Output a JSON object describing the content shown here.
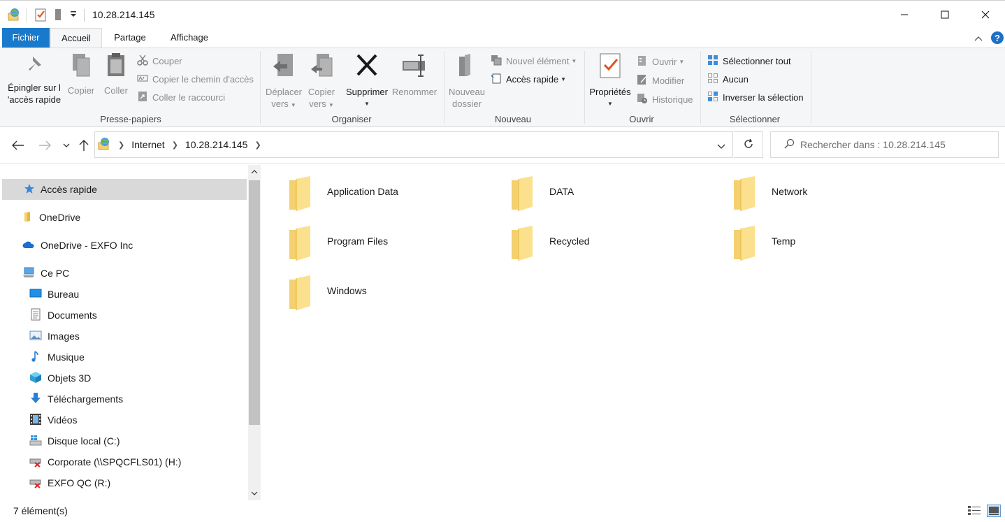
{
  "window": {
    "title": "10.28.214.145"
  },
  "ribbon_tabs": {
    "file": "Fichier",
    "home": "Accueil",
    "share": "Partage",
    "view": "Affichage"
  },
  "clipboard": {
    "pin_line1": "Épingler sur l",
    "pin_line2": "'accès rapide",
    "copy": "Copier",
    "paste": "Coller",
    "cut": "Couper",
    "copy_path": "Copier le chemin d'accès",
    "paste_shortcut": "Coller le raccourci",
    "group_label": "Presse-papiers"
  },
  "organize": {
    "move_line1": "Déplacer",
    "move_line2": "vers",
    "copyto_line1": "Copier",
    "copyto_line2": "vers",
    "delete": "Supprimer",
    "rename": "Renommer",
    "group_label": "Organiser"
  },
  "new": {
    "folder_line1": "Nouveau",
    "folder_line2": "dossier",
    "new_item": "Nouvel élément",
    "easy_access": "Accès rapide",
    "group_label": "Nouveau"
  },
  "open": {
    "properties": "Propriétés",
    "open": "Ouvrir",
    "edit": "Modifier",
    "history": "Historique",
    "group_label": "Ouvrir"
  },
  "select": {
    "select_all": "Sélectionner tout",
    "select_none": "Aucun",
    "invert": "Inverser la sélection",
    "group_label": "Sélectionner"
  },
  "address": {
    "crumbs": [
      "Internet",
      "10.28.214.145"
    ],
    "search_placeholder": "Rechercher dans : 10.28.214.145"
  },
  "navpane": {
    "items": [
      {
        "label": "Accès rapide",
        "icon": "star-icon",
        "selected": true
      },
      {
        "label": "OneDrive",
        "icon": "folder-icon"
      },
      {
        "label": "OneDrive - EXFO Inc",
        "icon": "cloud-icon"
      },
      {
        "label": "Ce PC",
        "icon": "computer-icon"
      },
      {
        "label": "Bureau",
        "icon": "desktop-icon"
      },
      {
        "label": "Documents",
        "icon": "document-icon"
      },
      {
        "label": "Images",
        "icon": "image-icon"
      },
      {
        "label": "Musique",
        "icon": "music-icon"
      },
      {
        "label": "Objets 3D",
        "icon": "cube-icon"
      },
      {
        "label": "Téléchargements",
        "icon": "download-icon"
      },
      {
        "label": "Vidéos",
        "icon": "video-icon"
      },
      {
        "label": "Disque local (C:)",
        "icon": "drive-icon"
      },
      {
        "label": "Corporate (\\\\SPQCFLS01) (H:)",
        "icon": "network-drive-disconnected-icon"
      },
      {
        "label": "EXFO QC (R:)",
        "icon": "network-drive-disconnected-icon"
      }
    ]
  },
  "content": {
    "folders": [
      "Application Data",
      "DATA",
      "Network",
      "Program Files",
      "Recycled",
      "Temp",
      "Windows"
    ]
  },
  "status": {
    "count": "7 élément(s)"
  },
  "colors": {
    "file_tab": "#1979ca",
    "folder": "#f4d06f",
    "selection": "#d9d9d9"
  }
}
